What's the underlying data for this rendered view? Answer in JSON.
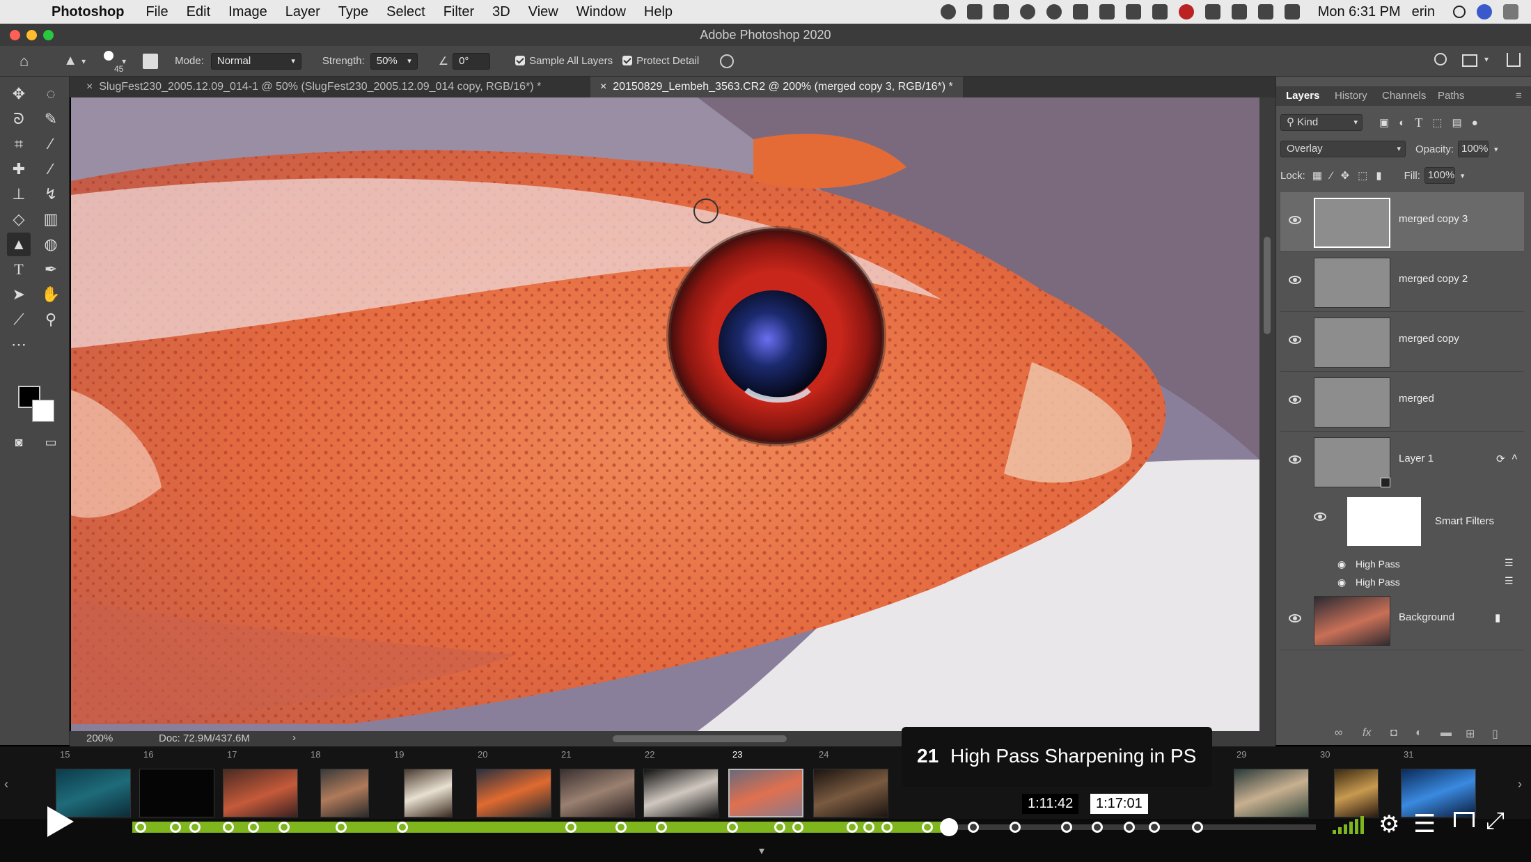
{
  "menubar": {
    "app_name": "Photoshop",
    "items": [
      "File",
      "Edit",
      "Image",
      "Layer",
      "Type",
      "Select",
      "Filter",
      "3D",
      "View",
      "Window",
      "Help"
    ],
    "clock": "Mon 6:31 PM",
    "user": "erin"
  },
  "window": {
    "title": "Adobe Photoshop 2020"
  },
  "options": {
    "brush_size": "45",
    "mode_label": "Mode:",
    "mode_value": "Normal",
    "strength_label": "Strength:",
    "strength_value": "50%",
    "angle_value": "0°",
    "sample_all_layers": "Sample All Layers",
    "protect_detail": "Protect Detail"
  },
  "tabs": [
    {
      "label": "SlugFest230_2005.12.09_014-1 @ 50% (SlugFest230_2005.12.09_014 copy, RGB/16*) *"
    },
    {
      "label": "20150829_Lembeh_3563.CR2 @ 200% (merged copy 3, RGB/16*) *"
    }
  ],
  "status": {
    "zoom": "200%",
    "doc": "Doc: 72.9M/437.6M"
  },
  "panel": {
    "tabs": [
      "Layers",
      "History",
      "Channels",
      "Paths"
    ],
    "filter_kind": "Kind",
    "blend_mode": "Overlay",
    "opacity_label": "Opacity:",
    "opacity_value": "100%",
    "lock_label": "Lock:",
    "fill_label": "Fill:",
    "fill_value": "100%",
    "layers": [
      {
        "name": "merged copy 3"
      },
      {
        "name": "merged copy 2"
      },
      {
        "name": "merged copy"
      },
      {
        "name": "merged"
      },
      {
        "name": "Layer 1"
      }
    ],
    "smart_filters": "Smart Filters",
    "filters": [
      "High Pass",
      "High Pass"
    ],
    "background": "Background"
  },
  "player": {
    "chapter_number": "21",
    "chapter_title": "High Pass Sharpening in PS",
    "current_time": "1:11:42",
    "hover_time": "1:17:01",
    "chapters": [
      "15",
      "16",
      "17",
      "18",
      "19",
      "20",
      "21",
      "22",
      "23",
      "24",
      "29",
      "30",
      "31"
    ],
    "progress": 0.69
  }
}
